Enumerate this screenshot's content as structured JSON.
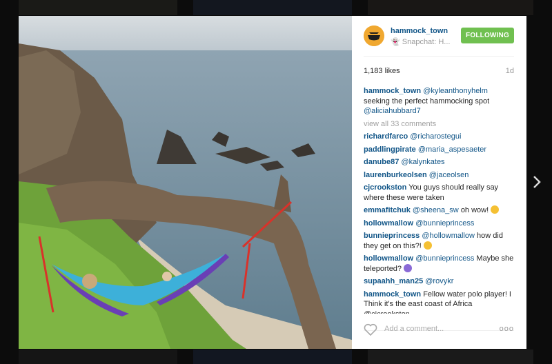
{
  "post": {
    "username": "hammock_town",
    "location": "👻 Snapchat: H...",
    "follow_label": "FOLLOWING",
    "likes": "1,183 likes",
    "age": "1d",
    "caption_user": "hammock_town",
    "caption_text": "@kyleanthonyhelm seeking the perfect hammocking spot @aliciahubbard7",
    "view_all": "view all 33 comments",
    "add_comment_placeholder": "Add a comment...",
    "more_label": "ooo"
  },
  "comments": [
    {
      "user": "richardfarco",
      "mention": "@richarostegui",
      "text": ""
    },
    {
      "user": "paddlingpirate",
      "mention": "@maria_aspesaeter",
      "text": ""
    },
    {
      "user": "danube87",
      "mention": "@kalynkates",
      "text": ""
    },
    {
      "user": "laurenburkeolsen",
      "mention": "@jaceolsen",
      "text": ""
    },
    {
      "user": "cjcrookston",
      "mention": "",
      "text": "You guys should really say where these were taken"
    },
    {
      "user": "emmafitchuk",
      "mention": "@sheena_sw",
      "text": "oh wow!"
    },
    {
      "user": "hollowmallow",
      "mention": "@bunnieprincess",
      "text": ""
    },
    {
      "user": "bunnieprincess",
      "mention": "@hollowmallow",
      "text": "how did they get on this?!"
    },
    {
      "user": "hollowmallow",
      "mention": "@bunnieprincess",
      "text": "Maybe she teleported?"
    },
    {
      "user": "supaahh_man25",
      "mention": "@rovykr",
      "text": ""
    },
    {
      "user": "hammock_town",
      "mention": "",
      "text": "Fellow water polo player! I Think it's the east coast of Africa @cjcrookston"
    }
  ],
  "icons": [
    "avatar-hammock-logo",
    "heart-icon",
    "more-options-icon",
    "chevron-right-icon"
  ],
  "colors": {
    "username": "#125688",
    "follow": "#70c050",
    "overlay": "#1c1c1c"
  }
}
